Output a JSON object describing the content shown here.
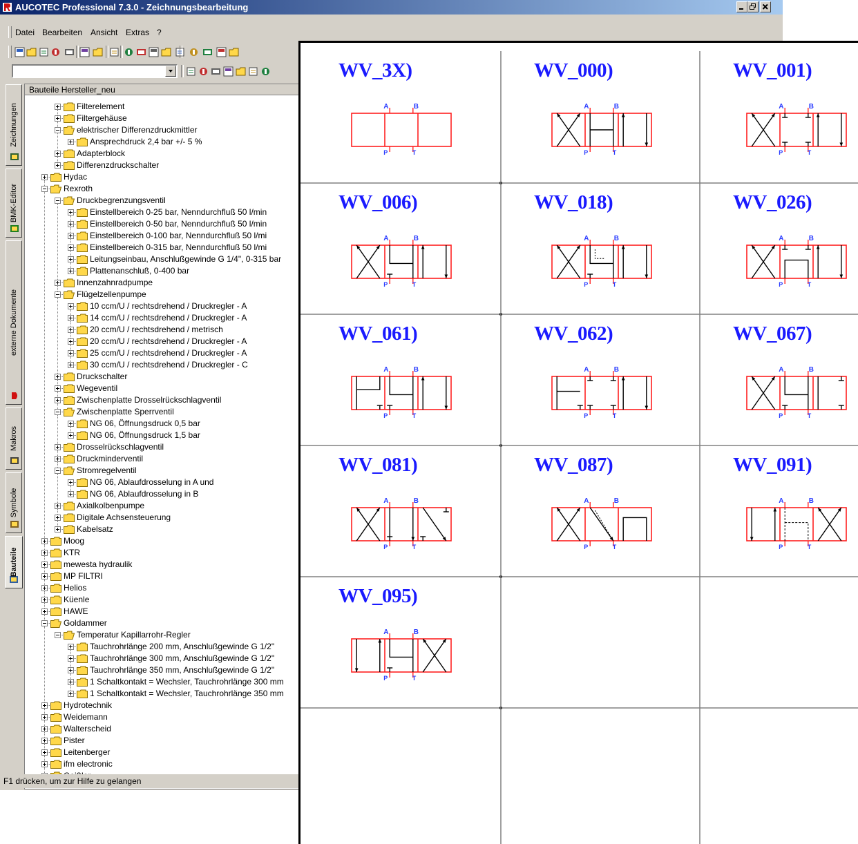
{
  "window": {
    "title": "AUCOTEC Professional 7.3.0 - Zeichnungsbearbeitung",
    "controls": [
      "_",
      "▫",
      "×"
    ]
  },
  "menu": [
    {
      "label": "Datei",
      "hotkey": "D"
    },
    {
      "label": "Bearbeiten",
      "hotkey": "B"
    },
    {
      "label": "Ansicht",
      "hotkey": "A"
    },
    {
      "label": "Extras",
      "hotkey": "E"
    },
    {
      "label": "?",
      "hotkey": "?"
    }
  ],
  "toolbar1": [
    "save-icon",
    "copy-icon",
    "open-icon",
    "close-icon",
    "import-icon",
    "print-icon",
    "preview-icon",
    "help-icon",
    "window-icon",
    "grid-icon",
    "layout-icon",
    "property-icon",
    "list-icon",
    "folder-icon",
    "report-icon",
    "transfer-icon",
    "book-icon"
  ],
  "toolbar2": [
    "page-icon",
    "back-icon",
    "forward-icon",
    "refresh-icon",
    "undo-icon",
    "search-icon",
    "find-icon"
  ],
  "vtabs": [
    {
      "label": "Zeichnungen",
      "icon": "drawings-icon",
      "active": false
    },
    {
      "label": "BMK-Editor",
      "icon": "bmk-icon",
      "active": false
    },
    {
      "label": "externe Dokumente",
      "icon": "documents-icon",
      "active": false
    },
    {
      "label": "Makros",
      "icon": "macros-icon",
      "active": false
    },
    {
      "label": "Symbole",
      "icon": "symbols-icon",
      "active": false
    },
    {
      "label": "Bauteile",
      "icon": "parts-icon",
      "active": true
    }
  ],
  "tree": {
    "header": "Bauteile Hersteller_neu",
    "items": [
      {
        "label": "Filterelement",
        "level": 2,
        "state": "collapsed"
      },
      {
        "label": "Filtergehäuse",
        "level": 2,
        "state": "collapsed"
      },
      {
        "label": "elektrischer Differenzdruckmittler",
        "level": 2,
        "state": "expanded"
      },
      {
        "label": "Ansprechdruck 2,4 bar  +/- 5 %",
        "level": 3,
        "state": "collapsed"
      },
      {
        "label": "Adapterblock",
        "level": 2,
        "state": "collapsed"
      },
      {
        "label": "Differenzdruckschalter",
        "level": 2,
        "state": "collapsed"
      },
      {
        "label": "Hydac",
        "level": 1,
        "state": "collapsed"
      },
      {
        "label": "Rexroth",
        "level": 1,
        "state": "expanded"
      },
      {
        "label": "Druckbegrenzungsventil",
        "level": 2,
        "state": "expanded"
      },
      {
        "label": "Einstellbereich 0-25 bar, Nenndurchfluß 50 l/min",
        "level": 3,
        "state": "collapsed"
      },
      {
        "label": "Einstellbereich 0-50 bar, Nenndurchfluß 50 l/min",
        "level": 3,
        "state": "collapsed"
      },
      {
        "label": "Einstellbereich 0-100 bar, Nenndurchfluß 50 l/mi",
        "level": 3,
        "state": "collapsed"
      },
      {
        "label": "Einstellbereich 0-315 bar, Nenndurchfluß 50 l/mi",
        "level": 3,
        "state": "collapsed"
      },
      {
        "label": "Leitungseinbau, Anschlußgewinde G 1/4\", 0-315 bar",
        "level": 3,
        "state": "collapsed"
      },
      {
        "label": "Plattenanschluß, 0-400 bar",
        "level": 3,
        "state": "collapsed"
      },
      {
        "label": "Innenzahnradpumpe",
        "level": 2,
        "state": "collapsed"
      },
      {
        "label": "Flügelzellenpumpe",
        "level": 2,
        "state": "expanded"
      },
      {
        "label": "10 ccm/U / rechtsdrehend / Druckregler - A",
        "level": 3,
        "state": "collapsed"
      },
      {
        "label": "14 ccm/U / rechtsdrehend / Druckregler - A",
        "level": 3,
        "state": "collapsed"
      },
      {
        "label": "20 ccm/U / rechtsdrehend / metrisch",
        "level": 3,
        "state": "collapsed"
      },
      {
        "label": "20 ccm/U / rechtsdrehend / Druckregler - A",
        "level": 3,
        "state": "collapsed"
      },
      {
        "label": "25 ccm/U / rechtsdrehend / Druckregler - A",
        "level": 3,
        "state": "collapsed"
      },
      {
        "label": "30 ccm/U / rechtsdrehend / Druckregler - C",
        "level": 3,
        "state": "collapsed"
      },
      {
        "label": "Druckschalter",
        "level": 2,
        "state": "collapsed"
      },
      {
        "label": "Wegeventil",
        "level": 2,
        "state": "collapsed"
      },
      {
        "label": "Zwischenplatte Drosselrückschlagventil",
        "level": 2,
        "state": "collapsed"
      },
      {
        "label": "Zwischenplatte Sperrventil",
        "level": 2,
        "state": "expanded"
      },
      {
        "label": "NG 06, Öffnungsdruck 0,5 bar",
        "level": 3,
        "state": "collapsed"
      },
      {
        "label": "NG 06, Öffnungsdruck 1,5 bar",
        "level": 3,
        "state": "collapsed"
      },
      {
        "label": "Drosselrückschlagventil",
        "level": 2,
        "state": "collapsed"
      },
      {
        "label": "Druckminderventil",
        "level": 2,
        "state": "collapsed"
      },
      {
        "label": "Stromregelventil",
        "level": 2,
        "state": "expanded"
      },
      {
        "label": "NG 06, Ablaufdrosselung in  A und",
        "level": 3,
        "state": "collapsed"
      },
      {
        "label": "NG 06, Ablaufdrosselung in B",
        "level": 3,
        "state": "collapsed"
      },
      {
        "label": "Axialkolbenpumpe",
        "level": 2,
        "state": "collapsed"
      },
      {
        "label": "Digitale Achsensteuerung",
        "level": 2,
        "state": "collapsed"
      },
      {
        "label": "Kabelsatz",
        "level": 2,
        "state": "collapsed"
      },
      {
        "label": "Moog",
        "level": 1,
        "state": "collapsed"
      },
      {
        "label": "KTR",
        "level": 1,
        "state": "collapsed"
      },
      {
        "label": "mewesta hydraulik",
        "level": 1,
        "state": "collapsed"
      },
      {
        "label": "MP FILTRI",
        "level": 1,
        "state": "collapsed"
      },
      {
        "label": "Helios",
        "level": 1,
        "state": "collapsed"
      },
      {
        "label": "Küenle",
        "level": 1,
        "state": "collapsed"
      },
      {
        "label": "HAWE",
        "level": 1,
        "state": "collapsed"
      },
      {
        "label": "Goldammer",
        "level": 1,
        "state": "expanded"
      },
      {
        "label": "Temperatur Kapillarrohr-Regler",
        "level": 2,
        "state": "expanded"
      },
      {
        "label": "Tauchrohrlänge 200 mm, Anschlußgewinde G 1/2\"",
        "level": 3,
        "state": "collapsed"
      },
      {
        "label": "Tauchrohrlänge 300 mm, Anschlußgewinde G 1/2\"",
        "level": 3,
        "state": "collapsed"
      },
      {
        "label": "Tauchrohrlänge 350 mm, Anschlußgewinde G 1/2\"",
        "level": 3,
        "state": "collapsed"
      },
      {
        "label": "1 Schaltkontakt = Wechsler, Tauchrohrlänge 300 mm",
        "level": 3,
        "state": "collapsed"
      },
      {
        "label": "1 Schaltkontakt = Wechsler, Tauchrohrlänge 350 mm",
        "level": 3,
        "state": "collapsed"
      },
      {
        "label": "Hydrotechnik",
        "level": 1,
        "state": "collapsed"
      },
      {
        "label": "Weidemann",
        "level": 1,
        "state": "collapsed"
      },
      {
        "label": "Walterscheid",
        "level": 1,
        "state": "collapsed"
      },
      {
        "label": "Pister",
        "level": 1,
        "state": "collapsed"
      },
      {
        "label": "Leitenberger",
        "level": 1,
        "state": "collapsed"
      },
      {
        "label": "ifm electronic",
        "level": 1,
        "state": "collapsed"
      },
      {
        "label": "Geißler",
        "level": 1,
        "state": "collapsed"
      }
    ]
  },
  "status": "F1 drücken, um zur Hilfe zu gelangen",
  "symbols": [
    {
      "label": "WV_3X)",
      "type": "3x"
    },
    {
      "label": "WV_000)",
      "type": "000"
    },
    {
      "label": "WV_001)",
      "type": "001"
    },
    {
      "label": "WV_006)",
      "type": "006"
    },
    {
      "label": "WV_018)",
      "type": "018"
    },
    {
      "label": "WV_026)",
      "type": "026"
    },
    {
      "label": "WV_061)",
      "type": "061"
    },
    {
      "label": "WV_062)",
      "type": "062"
    },
    {
      "label": "WV_067)",
      "type": "067"
    },
    {
      "label": "WV_081)",
      "type": "081"
    },
    {
      "label": "WV_087)",
      "type": "087"
    },
    {
      "label": "WV_091)",
      "type": "091"
    },
    {
      "label": "WV_095)",
      "type": "095"
    },
    {
      "label": "",
      "type": "empty"
    },
    {
      "label": "",
      "type": "empty"
    }
  ],
  "port_labels": {
    "a": "A",
    "b": "B",
    "p": "P",
    "t": "T"
  },
  "colors": {
    "titlebar_start": "#0a246a",
    "titlebar_end": "#a6caf0",
    "symbol_outline": "#ff2020",
    "symbol_label": "#1a1aff",
    "port_label": "#2a3cff",
    "folder": "#ffd84a"
  }
}
